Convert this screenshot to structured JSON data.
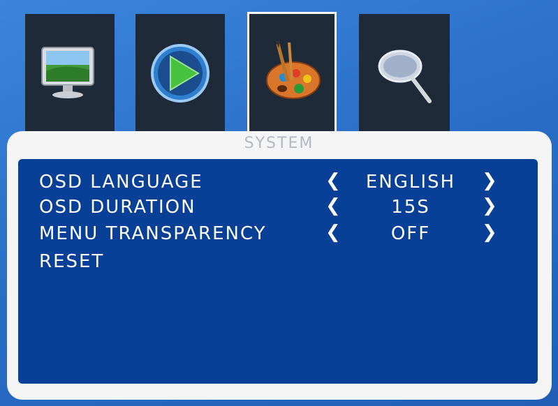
{
  "tabs": [
    {
      "icon": "monitor-icon",
      "selected": false
    },
    {
      "icon": "play-icon",
      "selected": false
    },
    {
      "icon": "palette-icon",
      "selected": true
    },
    {
      "icon": "magnifier-icon",
      "selected": false
    }
  ],
  "panel": {
    "title": "SYSTEM"
  },
  "menu": {
    "items": [
      {
        "label": "OSD LANGUAGE",
        "value": "ENGLISH",
        "left_arrow": "❮",
        "right_arrow": "❯"
      },
      {
        "label": "OSD DURATION",
        "value": "15S",
        "left_arrow": "❮",
        "right_arrow": "❯"
      },
      {
        "label": "MENU TRANSPARENCY",
        "value": "OFF",
        "left_arrow": "❮",
        "right_arrow": "❯"
      },
      {
        "label": "RESET"
      }
    ]
  },
  "colors": {
    "background": "#2a6fc8",
    "tab_bg": "#1f2a38",
    "panel_bg": "#f5f5f5",
    "menu_bg": "#083f97",
    "text": "#ffffff",
    "title": "#b4b8c2"
  }
}
